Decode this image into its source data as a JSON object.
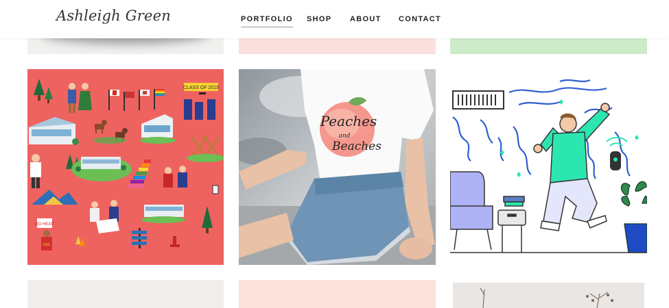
{
  "site": {
    "logo_text": "Ashleigh Green"
  },
  "nav": {
    "items": [
      {
        "label": "PORTFOLIO",
        "active": true
      },
      {
        "label": "SHOP"
      },
      {
        "label": "ABOUT"
      },
      {
        "label": "CONTACT"
      }
    ]
  },
  "portfolio": {
    "tiles": [
      {
        "name": "campus-illustration",
        "signs": [
          "CLASS OF 2019",
          "GO HEAT!",
          "USC"
        ]
      },
      {
        "name": "peaches-tshirt-photo",
        "shirt_text": [
          "Peaches",
          "and",
          "Beaches"
        ]
      },
      {
        "name": "jumping-man-illustration"
      }
    ]
  },
  "colors": {
    "strip_gray": "#f1f0ef",
    "strip_pink": "#fbe0df",
    "strip_green": "#cdeac9",
    "campus_bg": "#ee6360",
    "jumper_shirt": "#2ce6b0"
  }
}
